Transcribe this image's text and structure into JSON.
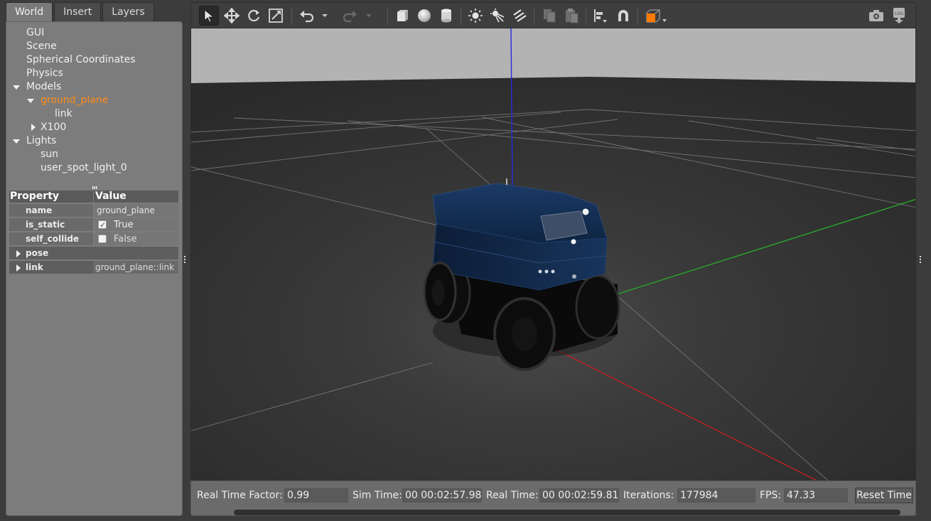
{
  "tabs": [
    {
      "label": "World",
      "active": true
    },
    {
      "label": "Insert",
      "active": false
    },
    {
      "label": "Layers",
      "active": false
    }
  ],
  "tree": {
    "gui": "GUI",
    "scene": "Scene",
    "spherical": "Spherical Coordinates",
    "physics": "Physics",
    "models": "Models",
    "ground_plane": "ground_plane",
    "link": "link",
    "x100": "X100",
    "lights": "Lights",
    "sun": "sun",
    "spot": "user_spot_light_0"
  },
  "properties": {
    "header_property": "Property",
    "header_value": "Value",
    "name_key": "name",
    "name_val": "ground_plane",
    "static_key": "is_static",
    "static_val": "True",
    "collide_key": "self_collide",
    "collide_val": "False",
    "pose_key": "pose",
    "link_key": "link",
    "link_val": "ground_plane::link"
  },
  "status": {
    "rtf_label": "Real Time Factor:",
    "rtf_value": "0.99",
    "sim_label": "Sim Time:",
    "sim_value": "00 00:02:57.984",
    "real_label": "Real Time:",
    "real_value": "00 00:02:59.812",
    "iter_label": "Iterations:",
    "iter_value": "177984",
    "fps_label": "FPS:",
    "fps_value": "47.33",
    "reset_label": "Reset Time"
  },
  "toolbar_icons": [
    "select-arrow-icon",
    "translate-icon",
    "rotate-icon",
    "scale-icon",
    "undo-icon",
    "undo-dropdown-icon",
    "redo-icon",
    "redo-dropdown-icon",
    "box-shape-icon",
    "sphere-shape-icon",
    "cylinder-shape-icon",
    "point-light-icon",
    "spot-light-icon",
    "directional-light-icon",
    "copy-icon",
    "paste-icon",
    "align-icon",
    "snap-magnet-icon",
    "view-angle-icon",
    "screenshot-icon",
    "log-icon"
  ],
  "colors": {
    "selection": "#ff8c1a",
    "robot_body": "#0f2440",
    "axis_x": "#b02020",
    "axis_y": "#20a020",
    "axis_z": "#2020d0"
  }
}
